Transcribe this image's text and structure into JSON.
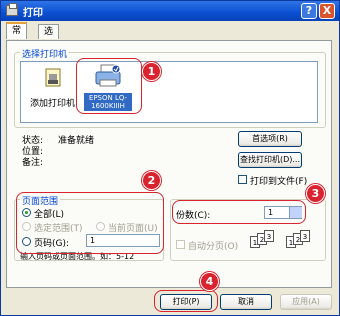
{
  "title": "打印",
  "titlebar": {
    "help": "?",
    "close": "X"
  },
  "tabs": [
    {
      "label": "常规",
      "active": true
    },
    {
      "label": "选项",
      "active": false
    }
  ],
  "select_printer": {
    "label": "选择打印机",
    "items": [
      {
        "label": "添加打印机",
        "icon": "add-printer-icon"
      },
      {
        "label": "EPSON LQ-1600KIIIH",
        "icon": "printer-icon",
        "selected": true
      }
    ]
  },
  "printer_info": {
    "status_label": "状态:",
    "status_value": "准备就绪",
    "location_label": "位置:",
    "location_value": "",
    "comment_label": "备注:",
    "comment_value": ""
  },
  "buttons": {
    "preferences": "首选项(R)",
    "find_printer": "查找打印机(D)...",
    "print": "打印(P)",
    "cancel": "取消",
    "apply": "应用(A)"
  },
  "print_to_file": "打印到文件(F)",
  "page_range": {
    "label": "页面范围",
    "all": "全部(L)",
    "selection": "选定范围(T)",
    "current_page": "当前页面(U)",
    "pages": "页码(G):",
    "pages_value": "1",
    "hint": "输入页码或页面范围。如：5-12"
  },
  "copies": {
    "label": "份数(C):",
    "value": "1",
    "collate": "自动分页(O)",
    "collate_icons": [
      "1",
      "2",
      "3"
    ]
  },
  "markers": [
    "1",
    "2",
    "3",
    "4"
  ],
  "colors": {
    "title_bar": "#0a4fd1",
    "annotation": "#d9232e",
    "group_title": "#0046d5"
  }
}
